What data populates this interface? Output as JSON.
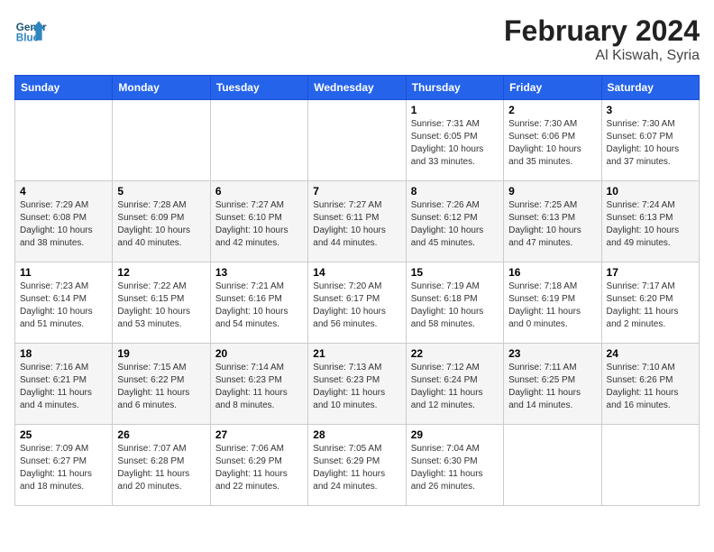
{
  "header": {
    "logo_line1": "General",
    "logo_line2": "Blue",
    "title": "February 2024",
    "subtitle": "Al Kiswah, Syria"
  },
  "weekdays": [
    "Sunday",
    "Monday",
    "Tuesday",
    "Wednesday",
    "Thursday",
    "Friday",
    "Saturday"
  ],
  "weeks": [
    [
      {
        "day": "",
        "empty": true
      },
      {
        "day": "",
        "empty": true
      },
      {
        "day": "",
        "empty": true
      },
      {
        "day": "",
        "empty": true
      },
      {
        "day": "1",
        "sunrise": "7:31 AM",
        "sunset": "6:05 PM",
        "daylight": "10 hours and 33 minutes."
      },
      {
        "day": "2",
        "sunrise": "7:30 AM",
        "sunset": "6:06 PM",
        "daylight": "10 hours and 35 minutes."
      },
      {
        "day": "3",
        "sunrise": "7:30 AM",
        "sunset": "6:07 PM",
        "daylight": "10 hours and 37 minutes."
      }
    ],
    [
      {
        "day": "4",
        "sunrise": "7:29 AM",
        "sunset": "6:08 PM",
        "daylight": "10 hours and 38 minutes."
      },
      {
        "day": "5",
        "sunrise": "7:28 AM",
        "sunset": "6:09 PM",
        "daylight": "10 hours and 40 minutes."
      },
      {
        "day": "6",
        "sunrise": "7:27 AM",
        "sunset": "6:10 PM",
        "daylight": "10 hours and 42 minutes."
      },
      {
        "day": "7",
        "sunrise": "7:27 AM",
        "sunset": "6:11 PM",
        "daylight": "10 hours and 44 minutes."
      },
      {
        "day": "8",
        "sunrise": "7:26 AM",
        "sunset": "6:12 PM",
        "daylight": "10 hours and 45 minutes."
      },
      {
        "day": "9",
        "sunrise": "7:25 AM",
        "sunset": "6:13 PM",
        "daylight": "10 hours and 47 minutes."
      },
      {
        "day": "10",
        "sunrise": "7:24 AM",
        "sunset": "6:13 PM",
        "daylight": "10 hours and 49 minutes."
      }
    ],
    [
      {
        "day": "11",
        "sunrise": "7:23 AM",
        "sunset": "6:14 PM",
        "daylight": "10 hours and 51 minutes."
      },
      {
        "day": "12",
        "sunrise": "7:22 AM",
        "sunset": "6:15 PM",
        "daylight": "10 hours and 53 minutes."
      },
      {
        "day": "13",
        "sunrise": "7:21 AM",
        "sunset": "6:16 PM",
        "daylight": "10 hours and 54 minutes."
      },
      {
        "day": "14",
        "sunrise": "7:20 AM",
        "sunset": "6:17 PM",
        "daylight": "10 hours and 56 minutes."
      },
      {
        "day": "15",
        "sunrise": "7:19 AM",
        "sunset": "6:18 PM",
        "daylight": "10 hours and 58 minutes."
      },
      {
        "day": "16",
        "sunrise": "7:18 AM",
        "sunset": "6:19 PM",
        "daylight": "11 hours and 0 minutes."
      },
      {
        "day": "17",
        "sunrise": "7:17 AM",
        "sunset": "6:20 PM",
        "daylight": "11 hours and 2 minutes."
      }
    ],
    [
      {
        "day": "18",
        "sunrise": "7:16 AM",
        "sunset": "6:21 PM",
        "daylight": "11 hours and 4 minutes."
      },
      {
        "day": "19",
        "sunrise": "7:15 AM",
        "sunset": "6:22 PM",
        "daylight": "11 hours and 6 minutes."
      },
      {
        "day": "20",
        "sunrise": "7:14 AM",
        "sunset": "6:23 PM",
        "daylight": "11 hours and 8 minutes."
      },
      {
        "day": "21",
        "sunrise": "7:13 AM",
        "sunset": "6:23 PM",
        "daylight": "11 hours and 10 minutes."
      },
      {
        "day": "22",
        "sunrise": "7:12 AM",
        "sunset": "6:24 PM",
        "daylight": "11 hours and 12 minutes."
      },
      {
        "day": "23",
        "sunrise": "7:11 AM",
        "sunset": "6:25 PM",
        "daylight": "11 hours and 14 minutes."
      },
      {
        "day": "24",
        "sunrise": "7:10 AM",
        "sunset": "6:26 PM",
        "daylight": "11 hours and 16 minutes."
      }
    ],
    [
      {
        "day": "25",
        "sunrise": "7:09 AM",
        "sunset": "6:27 PM",
        "daylight": "11 hours and 18 minutes."
      },
      {
        "day": "26",
        "sunrise": "7:07 AM",
        "sunset": "6:28 PM",
        "daylight": "11 hours and 20 minutes."
      },
      {
        "day": "27",
        "sunrise": "7:06 AM",
        "sunset": "6:29 PM",
        "daylight": "11 hours and 22 minutes."
      },
      {
        "day": "28",
        "sunrise": "7:05 AM",
        "sunset": "6:29 PM",
        "daylight": "11 hours and 24 minutes."
      },
      {
        "day": "29",
        "sunrise": "7:04 AM",
        "sunset": "6:30 PM",
        "daylight": "11 hours and 26 minutes."
      },
      {
        "day": "",
        "empty": true
      },
      {
        "day": "",
        "empty": true
      }
    ]
  ]
}
